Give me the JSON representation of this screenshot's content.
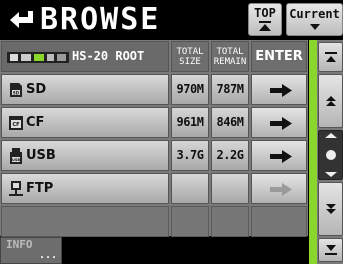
{
  "header": {
    "title": "BROWSE",
    "top_button_label": "TOP",
    "current_button_label": "Current"
  },
  "table": {
    "root_label": "HS-20 ROOT",
    "columns": {
      "total_size": "TOTAL SIZE",
      "total_remain": "TOTAL REMAIN",
      "enter": "ENTER"
    },
    "rows": [
      {
        "name": "SD",
        "total_size": "970M",
        "total_remain": "787M",
        "icon": "sd-card-icon",
        "enabled": true
      },
      {
        "name": "CF",
        "total_size": "961M",
        "total_remain": "846M",
        "icon": "cf-card-icon",
        "enabled": true
      },
      {
        "name": "USB",
        "total_size": "3.7G",
        "total_remain": "2.2G",
        "icon": "usb-icon",
        "enabled": true
      },
      {
        "name": "FTP",
        "total_size": "",
        "total_remain": "",
        "icon": "ftp-icon",
        "enabled": false
      }
    ]
  },
  "footer": {
    "info_label": "INFO",
    "info_more": "..."
  },
  "colors": {
    "scroll_accent": "#8bd62a",
    "background": "#000000",
    "panel": "#7a7a7a"
  }
}
